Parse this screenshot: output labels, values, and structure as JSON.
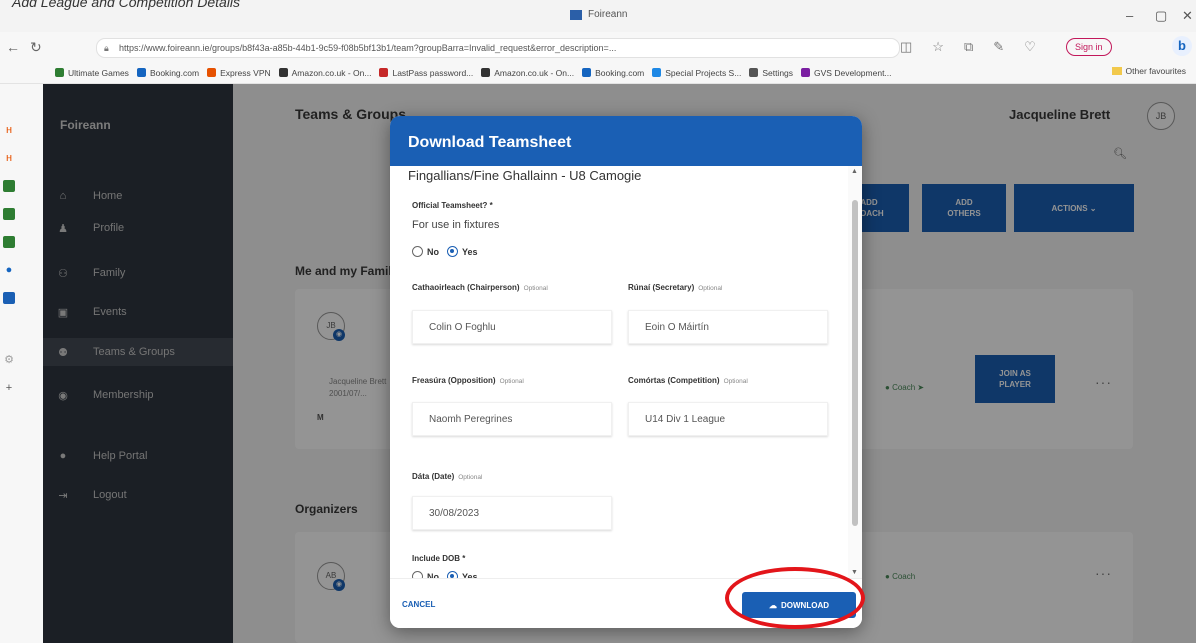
{
  "caption": "Add League and Competition Details",
  "browser": {
    "tab_title": "Foireann",
    "url": "https://www.foireann.ie/groups/b8f43a-a85b-44b1-9c59-f08b5bf13b1/team?groupBarra=Invalid_request&error_description=...",
    "sign_in": "Sign in",
    "bookmarks": [
      "Ultimate Games",
      "Booking.com",
      "Express VPN",
      "Amazon.co.uk - On...",
      "LastPass password...",
      "Amazon.co.uk - On...",
      "Booking.com",
      "Special Projects S...",
      "Settings",
      "GVS Development..."
    ],
    "bookmark_colors": [
      "#2e7d32",
      "#1565c0",
      "#e65100",
      "#333333",
      "#c62828",
      "#333333",
      "#1565c0",
      "#1e88e5",
      "#555555",
      "#7b1fa2"
    ],
    "other_favourites": "Other favourites"
  },
  "sidebar": {
    "brand": "Foireann",
    "items": [
      {
        "label": "Home",
        "icon": "home-icon",
        "glyph": "⌂"
      },
      {
        "label": "Profile",
        "icon": "profile-icon",
        "glyph": "♟"
      },
      {
        "label": "Family",
        "icon": "family-icon",
        "glyph": "⚇"
      },
      {
        "label": "Events",
        "icon": "calendar-icon",
        "glyph": "▣"
      },
      {
        "label": "Teams & Groups",
        "icon": "groups-icon",
        "glyph": "⚉"
      },
      {
        "label": "Membership",
        "icon": "membership-icon",
        "glyph": "◉"
      },
      {
        "label": "Help Portal",
        "icon": "help-icon",
        "glyph": "●"
      },
      {
        "label": "Logout",
        "icon": "logout-icon",
        "glyph": "⇥"
      }
    ]
  },
  "main": {
    "title": "Teams & Groups",
    "user_name": "Jacqueline Brett",
    "user_initials": "JB",
    "buttons": {
      "coach": "ADD\nCOACH",
      "others": "ADD\nOTHERS",
      "actions": "ACTIONS  ⌄"
    },
    "me_section": "Me and my Family",
    "organizers_section": "Organizers",
    "member": {
      "initials": "JB",
      "line1": "Jacqueline Brett",
      "line2": "2001/07/...",
      "grade": "M",
      "status": "Coach",
      "join_label": "JOIN AS\nPLAYER"
    },
    "organizer": {
      "initials": "AB",
      "status": "Coach"
    }
  },
  "modal": {
    "title": "Download Teamsheet",
    "team_name": "Fingallians/Fine Ghallainn - U8 Camogie",
    "official_label": "Official Teamsheet? *",
    "official_helper": "For use in fixtures",
    "no_label": "No",
    "yes_label": "Yes",
    "official_value": "Yes",
    "optional": "Optional",
    "chairperson_label": "Cathaoirleach (Chairperson)",
    "chairperson_value": "Colin O Foghlu",
    "secretary_label": "Rúnaí (Secretary)",
    "secretary_value": "Eoin O Máirtín",
    "opposition_label": "Freasúra (Opposition)",
    "opposition_value": "Naomh Peregrines",
    "competition_label": "Comórtas (Competition)",
    "competition_value": "U14 Div 1 League",
    "date_label": "Dáta (Date)",
    "date_value": "30/08/2023",
    "dob_label": "Include DOB *",
    "dob_value": "Yes",
    "cancel": "CANCEL",
    "download": "DOWNLOAD"
  },
  "accent_color": "#1a5fb4",
  "highlight_color": "#e3151a"
}
